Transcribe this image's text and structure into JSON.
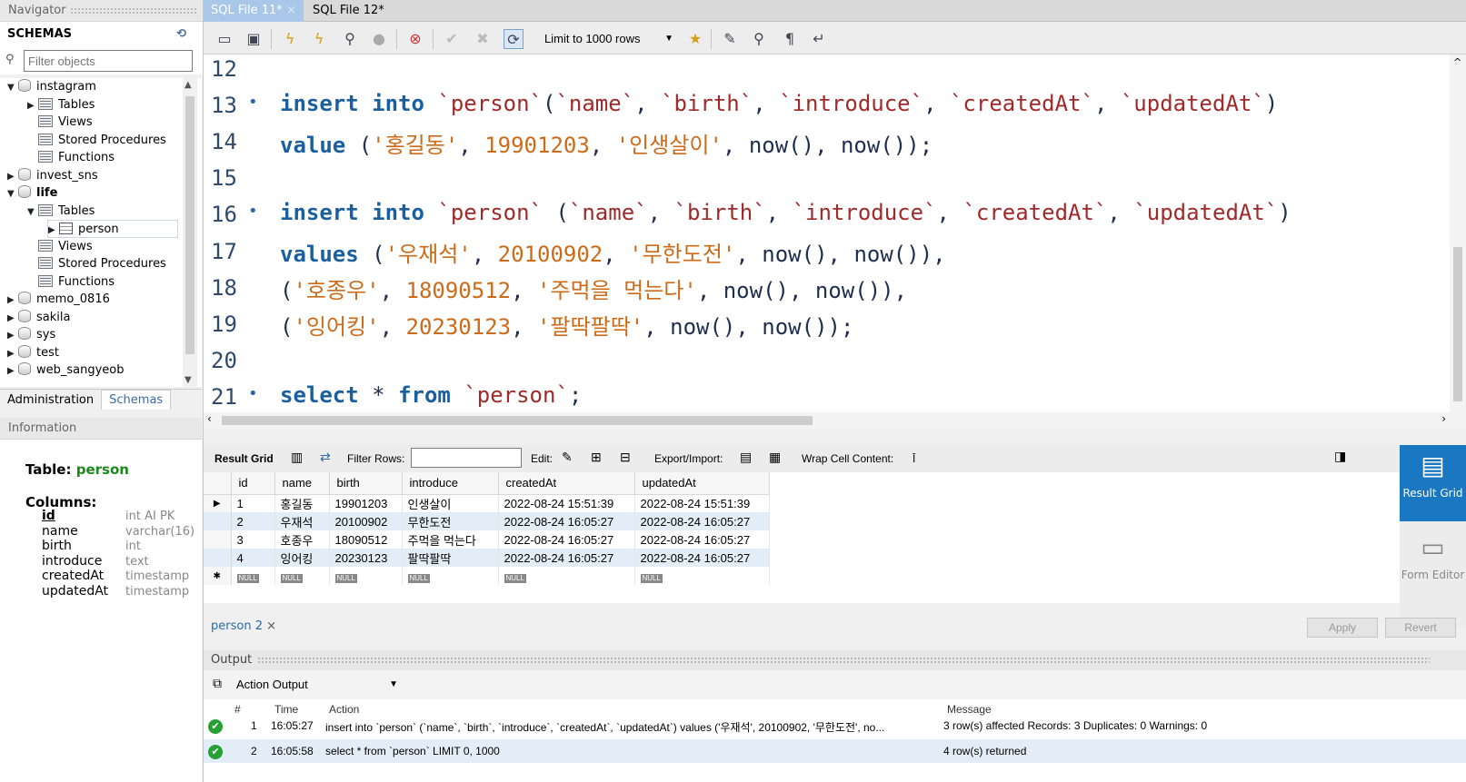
{
  "navigator": {
    "title": "Navigator",
    "schemas_title": "SCHEMAS",
    "filter_placeholder": "Filter objects",
    "tree": [
      {
        "label": "instagram",
        "level": 0,
        "type": "db",
        "expanded": true
      },
      {
        "label": "Tables",
        "level": 1,
        "type": "folder",
        "expanded": false
      },
      {
        "label": "Views",
        "level": 1,
        "type": "folder"
      },
      {
        "label": "Stored Procedures",
        "level": 1,
        "type": "folder"
      },
      {
        "label": "Functions",
        "level": 1,
        "type": "folder"
      },
      {
        "label": "invest_sns",
        "level": 0,
        "type": "db",
        "expanded": false
      },
      {
        "label": "life",
        "level": 0,
        "type": "db",
        "expanded": true,
        "bold": true
      },
      {
        "label": "Tables",
        "level": 1,
        "type": "folder",
        "expanded": true
      },
      {
        "label": "person",
        "level": 2,
        "type": "table",
        "selected": true
      },
      {
        "label": "Views",
        "level": 1,
        "type": "folder"
      },
      {
        "label": "Stored Procedures",
        "level": 1,
        "type": "folder"
      },
      {
        "label": "Functions",
        "level": 1,
        "type": "folder"
      },
      {
        "label": "memo_0816",
        "level": 0,
        "type": "db"
      },
      {
        "label": "sakila",
        "level": 0,
        "type": "db"
      },
      {
        "label": "sys",
        "level": 0,
        "type": "db"
      },
      {
        "label": "test",
        "level": 0,
        "type": "db"
      },
      {
        "label": "web_sangyeob",
        "level": 0,
        "type": "db"
      }
    ],
    "tabs": [
      "Administration",
      "Schemas"
    ]
  },
  "information": {
    "title": "Information",
    "table_label": "Table:",
    "table_name": "person",
    "columns_label": "Columns:",
    "columns": [
      {
        "name": "id",
        "type": "int AI PK"
      },
      {
        "name": "name",
        "type": "varchar(16)"
      },
      {
        "name": "birth",
        "type": "int"
      },
      {
        "name": "introduce",
        "type": "text"
      },
      {
        "name": "createdAt",
        "type": "timestamp"
      },
      {
        "name": "updatedAt",
        "type": "timestamp"
      }
    ]
  },
  "editor_tabs": [
    "SQL File 11*",
    "SQL File 12*"
  ],
  "toolbar": {
    "limit_label": "Limit to 1000 rows"
  },
  "editor": {
    "line_numbers": [
      "12",
      "13",
      "14",
      "15",
      "16",
      "17",
      "18",
      "19",
      "20",
      "21"
    ]
  },
  "result_toolbar": {
    "result_grid": "Result Grid",
    "filter_rows": "Filter Rows:",
    "edit": "Edit:",
    "export_import": "Export/Import:",
    "wrap": "Wrap Cell Content:"
  },
  "grid": {
    "headers": [
      "id",
      "name",
      "birth",
      "introduce",
      "createdAt",
      "updatedAt"
    ],
    "rows": [
      [
        "1",
        "홍길동",
        "19901203",
        "인생살이",
        "2022-08-24 15:51:39",
        "2022-08-24 15:51:39"
      ],
      [
        "2",
        "우재석",
        "20100902",
        "무한도전",
        "2022-08-24 16:05:27",
        "2022-08-24 16:05:27"
      ],
      [
        "3",
        "호종우",
        "18090512",
        "주먹을 먹는다",
        "2022-08-24 16:05:27",
        "2022-08-24 16:05:27"
      ],
      [
        "4",
        "잉어킹",
        "20230123",
        "팔딱팔딱",
        "2022-08-24 16:05:27",
        "2022-08-24 16:05:27"
      ]
    ],
    "null_label": "NULL"
  },
  "side_buttons": {
    "result_grid": "Result Grid",
    "form_editor": "Form Editor"
  },
  "result_tab": "person 2",
  "apply": "Apply",
  "revert": "Revert",
  "output": {
    "title": "Output",
    "selector": "Action Output",
    "headers": [
      "#",
      "Time",
      "Action",
      "Message"
    ],
    "rows": [
      {
        "n": "1",
        "time": "16:05:27",
        "action": "insert into `person` (`name`, `birth`, `introduce`, `createdAt`, `updatedAt`) values ('우재석', 20100902, '무한도전', no...",
        "message": "3 row(s) affected Records: 3  Duplicates: 0  Warnings: 0"
      },
      {
        "n": "2",
        "time": "16:05:58",
        "action": "select * from `person` LIMIT 0, 1000",
        "message": "4 row(s) returned"
      }
    ]
  }
}
